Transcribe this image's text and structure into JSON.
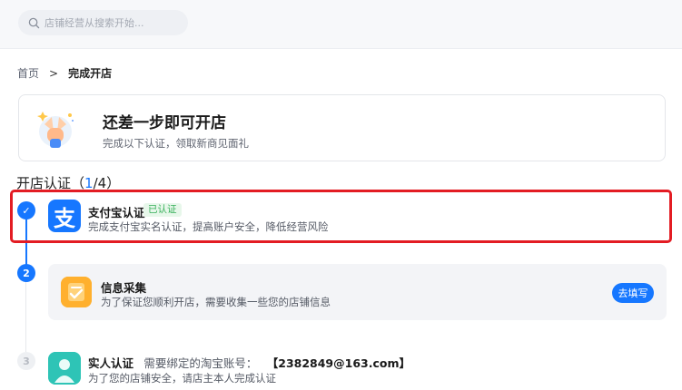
{
  "search": {
    "placeholder": "店铺经营从搜索开始..."
  },
  "breadcrumb": {
    "home": "首页",
    "separator": ">",
    "current": "完成开店"
  },
  "banner": {
    "title": "还差一步即可开店",
    "subtitle": "完成以下认证，领取新商见面礼"
  },
  "section": {
    "title": "开店认证",
    "progress_open": "（",
    "progress_done": "1",
    "progress_total": "/4",
    "progress_close": "）"
  },
  "steps": [
    {
      "index": "✓",
      "title": "支付宝认证",
      "badge": "已认证",
      "desc": "完成支付宝实名认证，提高账户安全，降低经营风险",
      "icon": "alipay-icon",
      "icon_glyph": "支"
    },
    {
      "index": "2",
      "title": "信息采集",
      "desc": "为了保证您顺利开店，需要收集一些您的店铺信息",
      "button": "去填写",
      "icon": "form-icon"
    },
    {
      "index": "3",
      "title": "实人认证",
      "inline_label": "需要绑定的淘宝账号：",
      "account": "【2382849@163.com】",
      "desc": "为了您的店铺安全，请店主本人完成认证",
      "icon": "person-icon"
    }
  ],
  "colors": {
    "accent": "#1677ff",
    "highlight": "#e31c23",
    "verified": "#37b05a"
  }
}
